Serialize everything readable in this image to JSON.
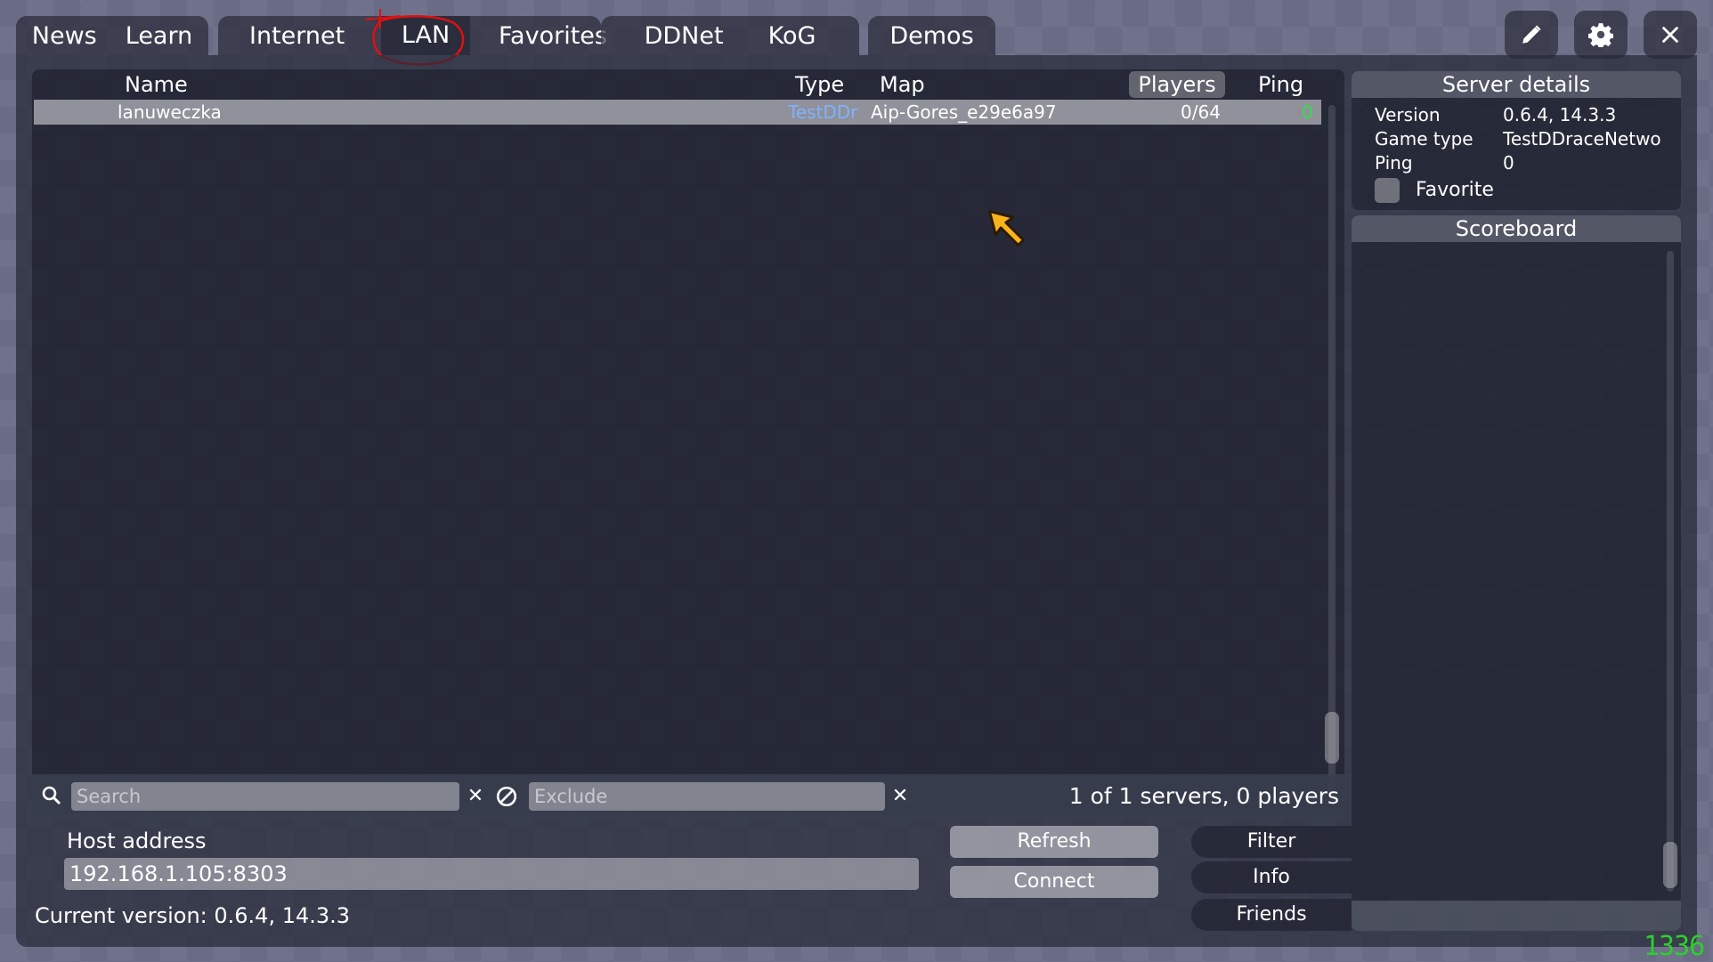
{
  "tabs": [
    "News",
    "Learn",
    "Internet",
    "LAN",
    "Favorites",
    "DDNet",
    "KoG",
    "Demos"
  ],
  "icons": {
    "edit": "pencil-icon",
    "settings": "gear-icon",
    "close": "close-icon",
    "search": "search-icon",
    "exclude": "exclude-icon"
  },
  "columns": {
    "name": "Name",
    "type": "Type",
    "map": "Map",
    "players": "Players",
    "ping": "Ping"
  },
  "servers": [
    {
      "name": "lanuweczka",
      "type": "TestDDr",
      "map": "Aip-Gores_e29e6a97",
      "players": "0/64",
      "ping": "0"
    }
  ],
  "filter": {
    "search_placeholder": "Search",
    "exclude_placeholder": "Exclude",
    "status": "1 of 1 servers, 0 players"
  },
  "host": {
    "label": "Host address",
    "value": "192.168.1.105:8303"
  },
  "version_text": "Current version: 0.6.4, 14.3.3",
  "actions": {
    "refresh": "Refresh",
    "connect": "Connect"
  },
  "side_tabs": [
    "Filter",
    "Info",
    "Friends"
  ],
  "details": {
    "title": "Server details",
    "rows": [
      {
        "label": "Version",
        "value": "0.6.4, 14.3.3"
      },
      {
        "label": "Game type",
        "value": "TestDDraceNetwo"
      },
      {
        "label": "Ping",
        "value": "0"
      }
    ],
    "favorite_label": "Favorite"
  },
  "scoreboard": {
    "title": "Scoreboard"
  },
  "fps": "1336",
  "colors": {
    "type_link": "#7fb2ff",
    "ping_good": "#33e04a",
    "annotation": "#e01010",
    "fps": "#2ccf2c",
    "cursor": "#f7b21c"
  }
}
